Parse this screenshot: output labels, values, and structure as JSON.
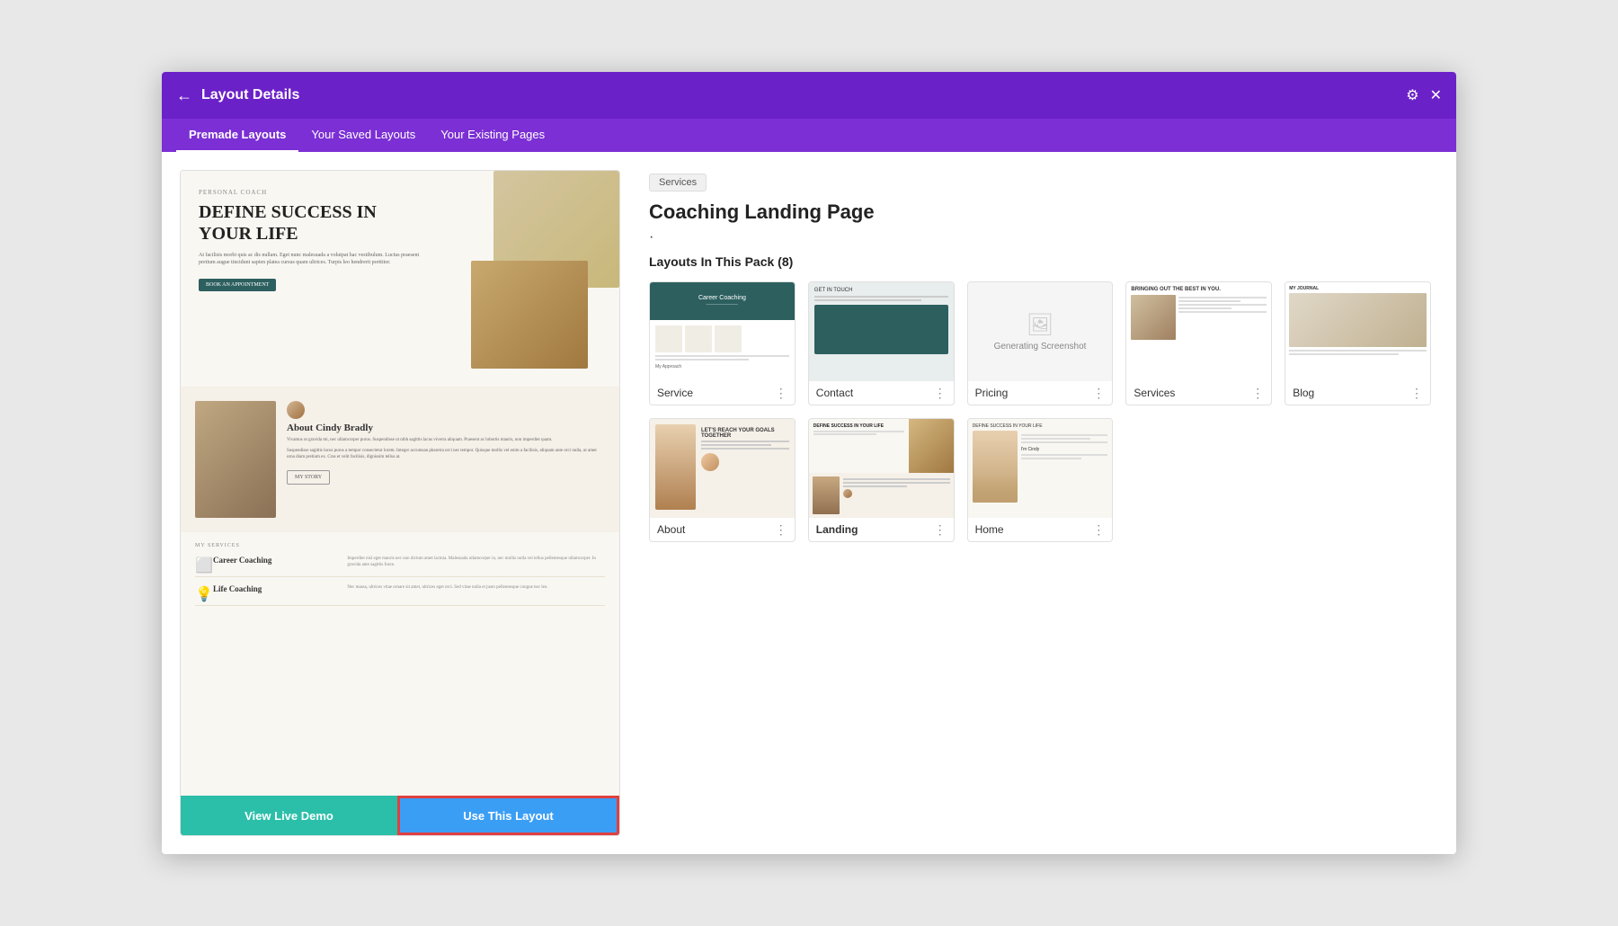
{
  "modal": {
    "title": "Layout Details",
    "back_icon": "←",
    "settings_icon": "⚙",
    "close_icon": "✕"
  },
  "tabs": [
    {
      "label": "Premade Layouts",
      "active": true
    },
    {
      "label": "Your Saved Layouts",
      "active": false
    },
    {
      "label": "Your Existing Pages",
      "active": false
    }
  ],
  "category_badge": "Services",
  "pack_title": "Coaching Landing Page",
  "pack_dot": "·",
  "layouts_label": "Layouts In This Pack (8)",
  "layouts": [
    {
      "name": "Service",
      "bold": false
    },
    {
      "name": "Contact",
      "bold": false
    },
    {
      "name": "Pricing",
      "bold": false
    },
    {
      "name": "Services",
      "bold": false
    },
    {
      "name": "Blog",
      "bold": false
    },
    {
      "name": "About",
      "bold": false
    },
    {
      "name": "Landing",
      "bold": true
    },
    {
      "name": "Home",
      "bold": false
    }
  ],
  "preview": {
    "coach_label": "PERSONAL COACH",
    "headline": "DEFINE SUCCESS IN YOUR LIFE",
    "body_text": "At facilisis morbi quis ac dis nullam. Eget nunc malesuada a volutpat hac vestibulum. Luctus praesent pretium augue tincidunt sapien platea cursus quam ultrices. Turpis leo hendrerit porttitor.",
    "cta_button": "BOOK AN APPOINTMENT",
    "about_name": "About Cindy Bradly",
    "about_text": "Vivamus ut gravida mi, nec ullamcorper purus. Suspendisse ut nibh sagittis lacus viverra aliquam. Praesent ac lobortis mauris, non imperdiet quam.",
    "my_story": "MY STORY",
    "services_label": "MY SERVICES",
    "service1_name": "Career Coaching",
    "service1_desc": "Imperdiet nisl eget mauris nec non dictum amet lacinia. Malesuada ullamcorper in, nec mollis nulla vel tellus pellentesque ullamcorper. In gravida ante sagittis fusce.",
    "service2_name": "Life Coaching",
    "service2_desc": "Nec massa, ultrices vitae ornare sit amet, ultrices eget orci. Sed vitae nulla et justo pellentesque congue nec leo."
  },
  "buttons": {
    "view_demo": "View Live Demo",
    "use_layout": "Use This Layout"
  }
}
